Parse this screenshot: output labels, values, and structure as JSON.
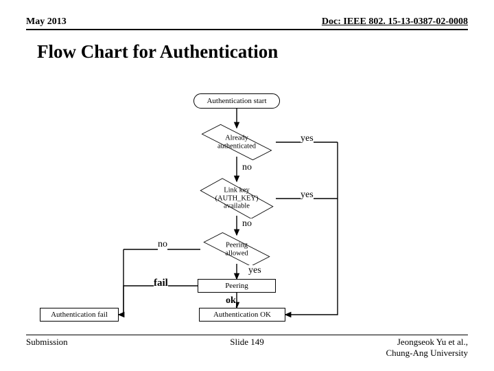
{
  "header": {
    "date": "May 2013",
    "doc": "Doc: IEEE 802. 15-13-0387-02-0008"
  },
  "title": "Flow Chart for Authentication",
  "footer": {
    "left": "Submission",
    "center": "Slide 149",
    "right_line1": "Jeongseok Yu et al.,",
    "right_line2": "Chung-Ang University"
  },
  "nodes": {
    "start": "Authentication start",
    "already": "Already\nauthenticated",
    "linkkey": "Link key\n(AUTH_KEY)\navailable",
    "peering_allowed": "Peering\nallowed",
    "peering": "Peering",
    "auth_fail": "Authentication fail",
    "auth_ok": "Authentication OK"
  },
  "labels": {
    "yes1": "yes",
    "no1": "no",
    "yes2": "yes",
    "no2": "no",
    "no3": "no",
    "yes3": "yes",
    "fail": "fail",
    "ok": "ok"
  },
  "chart_data": {
    "type": "flowchart",
    "title": "Flow Chart for Authentication",
    "nodes": [
      {
        "id": "start",
        "type": "terminator",
        "label": "Authentication start"
      },
      {
        "id": "already",
        "type": "decision",
        "label": "Already authenticated"
      },
      {
        "id": "linkkey",
        "type": "decision",
        "label": "Link key (AUTH_KEY) available"
      },
      {
        "id": "peering_allowed",
        "type": "decision",
        "label": "Peering allowed"
      },
      {
        "id": "peering",
        "type": "process",
        "label": "Peering"
      },
      {
        "id": "auth_fail",
        "type": "process",
        "label": "Authentication fail"
      },
      {
        "id": "auth_ok",
        "type": "process",
        "label": "Authentication OK"
      }
    ],
    "edges": [
      {
        "from": "start",
        "to": "already",
        "label": ""
      },
      {
        "from": "already",
        "to": "auth_ok",
        "label": "yes"
      },
      {
        "from": "already",
        "to": "linkkey",
        "label": "no"
      },
      {
        "from": "linkkey",
        "to": "auth_ok",
        "label": "yes"
      },
      {
        "from": "linkkey",
        "to": "peering_allowed",
        "label": "no"
      },
      {
        "from": "peering_allowed",
        "to": "auth_fail",
        "label": "no"
      },
      {
        "from": "peering_allowed",
        "to": "peering",
        "label": "yes"
      },
      {
        "from": "peering",
        "to": "auth_fail",
        "label": "fail"
      },
      {
        "from": "peering",
        "to": "auth_ok",
        "label": "ok"
      }
    ]
  }
}
